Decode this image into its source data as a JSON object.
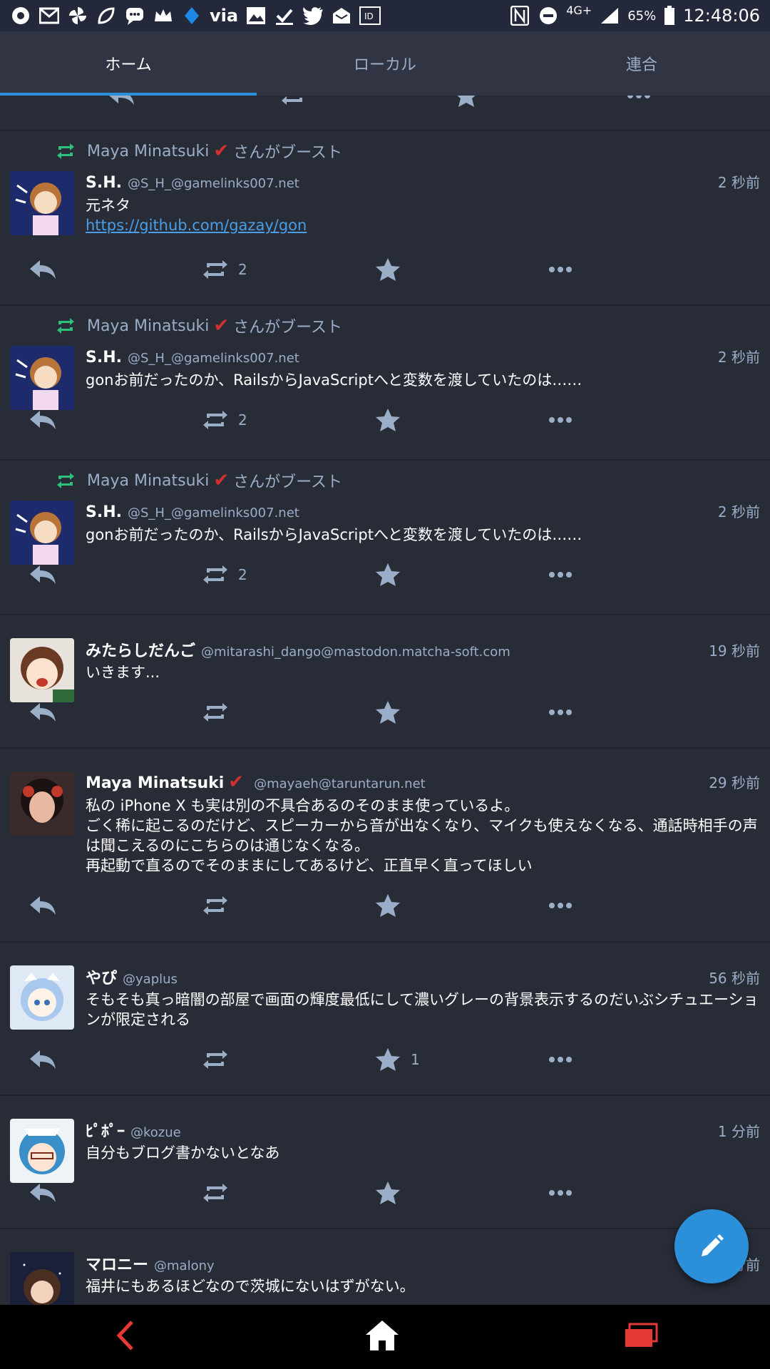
{
  "status_bar": {
    "via_label": "via",
    "network": "4G+",
    "battery": "65%",
    "time": "12:48:06"
  },
  "tabs": [
    {
      "label": "ホーム",
      "active": true
    },
    {
      "label": "ローカル",
      "active": false
    },
    {
      "label": "連合",
      "active": false
    }
  ],
  "boost_suffix": "さんがブースト",
  "statuses": [
    {
      "boosted_by": "Maya Minatsuki",
      "name": "S.H.",
      "acct": "@S_H_@gamelinks007.net",
      "time": "2 秒前",
      "text": "元ネタ",
      "link": "https://github.com/gazay/gon",
      "reblogs": "2",
      "favs": ""
    },
    {
      "boosted_by": "Maya Minatsuki",
      "name": "S.H.",
      "acct": "@S_H_@gamelinks007.net",
      "time": "2 秒前",
      "text": "gonお前だったのか、RailsからJavaScriptへと変数を渡していたのは……",
      "reblogs": "2",
      "favs": ""
    },
    {
      "boosted_by": "Maya Minatsuki",
      "name": "S.H.",
      "acct": "@S_H_@gamelinks007.net",
      "time": "2 秒前",
      "text": "gonお前だったのか、RailsからJavaScriptへと変数を渡していたのは……",
      "reblogs": "2",
      "favs": ""
    },
    {
      "name": "みたらしだんご",
      "acct": "@mitarashi_dango@mastodon.matcha-soft.com",
      "time": "19 秒前",
      "text": "いきます...",
      "reblogs": "",
      "favs": ""
    },
    {
      "name": "Maya Minatsuki",
      "acct": "@mayaeh@taruntarun.net",
      "time": "29 秒前",
      "text": "私の iPhone X も実は別の不具合あるのそのまま使っているよ。\nごく稀に起こるのだけど、スピーカーから音が出なくなり、マイクも使えなくなる、通話時相手の声は聞こえるのにこちらのは通じなくなる。\n再起動で直るのでそのままにしてあるけど、正直早く直ってほしい",
      "reblogs": "",
      "favs": ""
    },
    {
      "name": "やぴ",
      "acct": "@yaplus",
      "time": "56 秒前",
      "text": "そもそも真っ暗闇の部屋で画面の輝度最低にして濃いグレーの背景表示するのだいぶシチュエーションが限定される",
      "reblogs": "",
      "favs": "1"
    },
    {
      "name": "ﾋﾟﾎﾟｰ",
      "acct": "@kozue",
      "time": "1 分前",
      "text": "自分もブログ書かないとなあ",
      "reblogs": "",
      "favs": ""
    },
    {
      "name": "マロニー",
      "acct": "@malony",
      "time": "1 分前",
      "text": "福井にもあるほどなので茨城にないはずがない。",
      "reblogs": "",
      "favs": ""
    }
  ],
  "colors": {
    "background": "#282c37",
    "accent": "#2b90d9",
    "boost_green": "#2ec07a",
    "verified_red": "#d32f2f"
  }
}
